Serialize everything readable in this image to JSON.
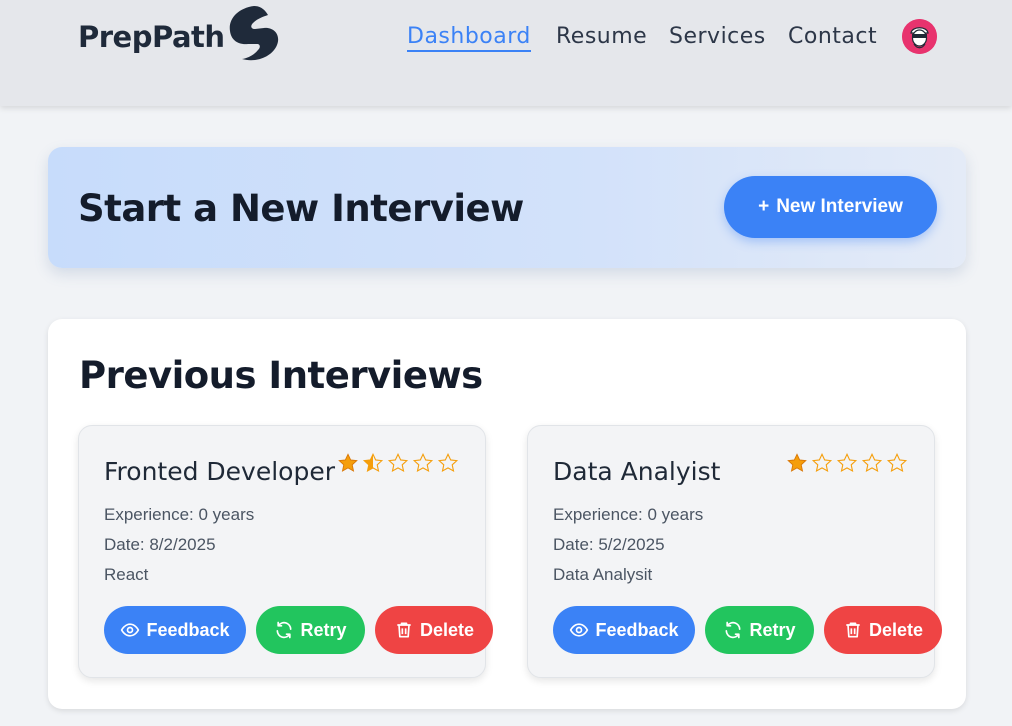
{
  "nav": {
    "brand": "PrepPath",
    "links": [
      {
        "label": "Dashboard",
        "active": true
      },
      {
        "label": "Resume",
        "active": false
      },
      {
        "label": "Services",
        "active": false
      },
      {
        "label": "Contact",
        "active": false
      }
    ],
    "avatar_icon": "user-avatar-icon"
  },
  "hero": {
    "title": "Start a New Interview",
    "button_label": "New Interview",
    "button_icon": "+"
  },
  "previous": {
    "title": "Previous Interviews",
    "cards": [
      {
        "title": "Fronted Developer",
        "rating": 1.5,
        "rating_max": 5,
        "experience": "Experience: 0 years",
        "date": "Date: 8/2/2025",
        "tech": "React",
        "feedback_label": "Feedback",
        "retry_label": "Retry",
        "delete_label": "Delete"
      },
      {
        "title": "Data Analyist",
        "rating": 1,
        "rating_max": 5,
        "experience": "Experience: 0 years",
        "date": "Date: 5/2/2025",
        "tech": "Data Analysit",
        "feedback_label": "Feedback",
        "retry_label": "Retry",
        "delete_label": "Delete"
      }
    ]
  },
  "colors": {
    "primary": "#3b82f6",
    "success": "#22c55e",
    "danger": "#ef4444",
    "star": "#f59e0b"
  }
}
